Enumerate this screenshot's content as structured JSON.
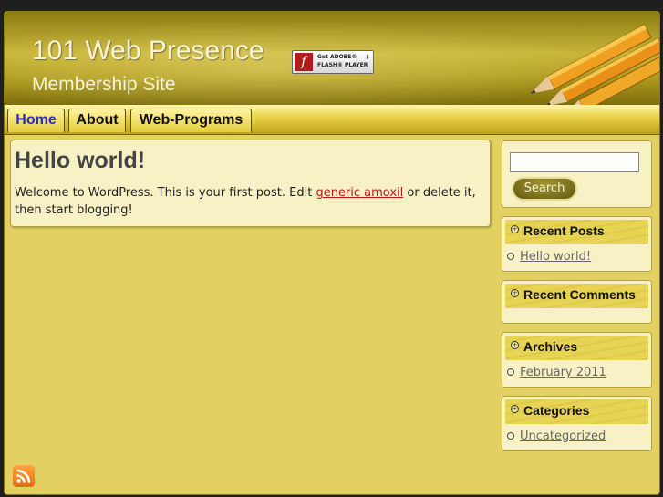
{
  "header": {
    "site_title": "101 Web Presence",
    "site_subtitle": "Membership Site",
    "flash_badge": {
      "line1": "Get ADOBE®",
      "line2": "FLASH® PLAYER",
      "icon": "flash-logo-icon"
    }
  },
  "nav": {
    "tabs": [
      {
        "label": "Home",
        "active": true
      },
      {
        "label": "About",
        "active": false
      },
      {
        "label": "Web-Programs",
        "active": false
      }
    ]
  },
  "post": {
    "title": "Hello world!",
    "text_before_link": "Welcome to WordPress. This is your first post. Edit ",
    "link_text": "generic amoxil",
    "text_after_link": " or delete it, then start blogging!"
  },
  "sidebar": {
    "search": {
      "value": "",
      "button_label": "Search"
    },
    "widgets": {
      "recent_posts": {
        "title": "Recent Posts",
        "items": [
          "Hello world!"
        ]
      },
      "recent_comments": {
        "title": "Recent Comments",
        "items": []
      },
      "archives": {
        "title": "Archives",
        "items": [
          "February 2011"
        ]
      },
      "categories": {
        "title": "Categories",
        "items": [
          "Uncategorized"
        ]
      }
    }
  },
  "footer": {
    "rss_icon": "rss-feed-icon"
  },
  "colors": {
    "page_background": "#e2d162",
    "active_tab_text": "#2b27c9",
    "link_red": "#c0161a",
    "rss_orange": "#f08a24"
  }
}
